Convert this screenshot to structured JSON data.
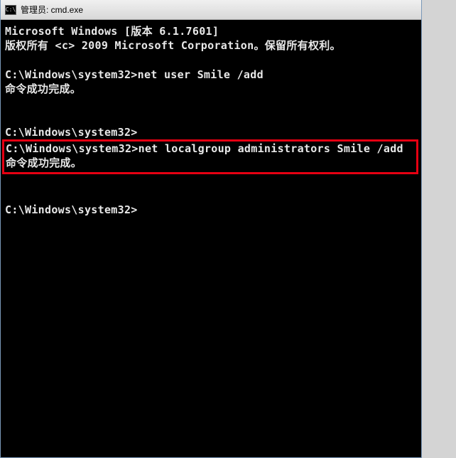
{
  "titlebar": {
    "icon_text": "C:\\",
    "title": "管理员: cmd.exe"
  },
  "terminal": {
    "line_version": "Microsoft Windows [版本 6.1.7601]",
    "line_copyright": "版权所有 <c> 2009 Microsoft Corporation。保留所有权利。",
    "blank": "",
    "prompt1": "C:\\Windows\\system32>",
    "cmd1": "net user Smile /add",
    "success1": "命令成功完成。",
    "prompt2": "C:\\Windows\\system32>",
    "prompt3": "C:\\Windows\\system32>",
    "cmd3": "net localgroup administrators Smile /add",
    "success3": "命令成功完成。",
    "prompt4": "C:\\Windows\\system32>"
  }
}
